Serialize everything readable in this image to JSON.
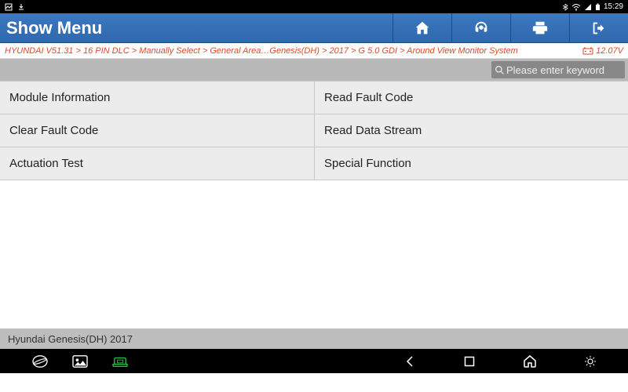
{
  "status_bar": {
    "time": "15:29"
  },
  "header": {
    "title": "Show Menu"
  },
  "breadcrumb": {
    "text": "HYUNDAI V51.31 > 16 PIN DLC > Manually Select > General Area…Genesis(DH) > 2017 > G 5.0 GDI > Around View Monitor System",
    "voltage": "12.07V"
  },
  "search": {
    "placeholder": "Please enter keyword"
  },
  "menu_items": [
    "Module Information",
    "Read Fault Code",
    "Clear Fault Code",
    "Read Data Stream",
    "Actuation Test",
    "Special Function"
  ],
  "footer": {
    "vehicle": "Hyundai Genesis(DH) 2017"
  }
}
